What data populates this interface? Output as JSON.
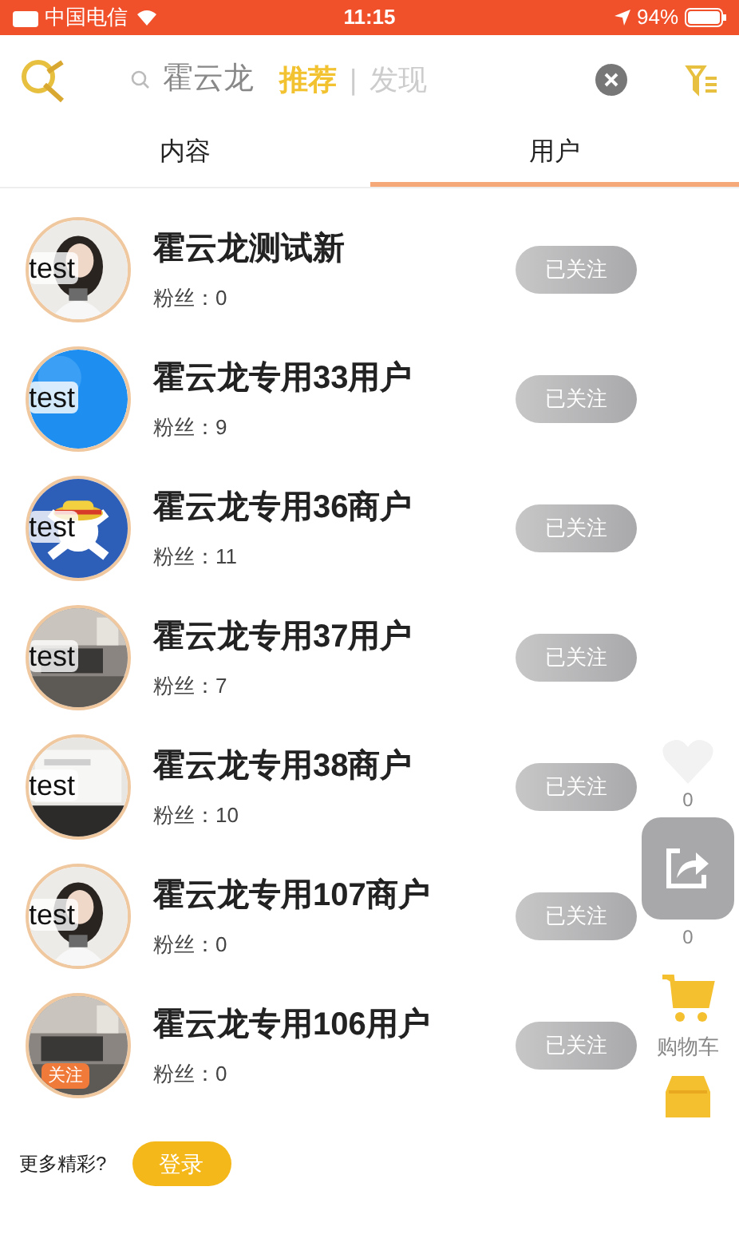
{
  "status_bar": {
    "carrier": "中国电信",
    "time": "11:15",
    "battery": "94%"
  },
  "search": {
    "query": "霍云龙",
    "links": [
      {
        "label": "推荐",
        "selected": true
      },
      {
        "label": "发现",
        "selected": false
      }
    ],
    "separator": "|"
  },
  "tabs": [
    {
      "label": "内容",
      "selected": false
    },
    {
      "label": "用户",
      "selected": true
    }
  ],
  "users": [
    {
      "name": "霍云龙测试新",
      "fans_label": "粉丝：",
      "fans": "0",
      "avatar_label": "test",
      "button": "已关注"
    },
    {
      "name": "霍云龙专用33用户",
      "fans_label": "粉丝：",
      "fans": "9",
      "avatar_label": "test",
      "avatar": {
        "kind": "blue"
      },
      "button": "已关注"
    },
    {
      "name": "霍云龙专用36商户",
      "fans_label": "粉丝：",
      "fans": "11",
      "avatar_label": "test",
      "avatar": {
        "kind": "emblem"
      },
      "button": "已关注"
    },
    {
      "name": "霍云龙专用37用户",
      "fans_label": "粉丝：",
      "fans": "7",
      "avatar_label": "test",
      "avatar": {
        "kind": "room"
      },
      "button": "已关注"
    },
    {
      "name": "霍云龙专用38商户",
      "fans_label": "粉丝：",
      "fans": "10",
      "avatar_label": "test",
      "avatar": {
        "kind": "screen"
      },
      "button": "已关注"
    },
    {
      "name": "霍云龙专用107商户",
      "fans_label": "粉丝：",
      "fans": "0",
      "avatar_label": "test",
      "button": "已关注"
    },
    {
      "name": "霍云龙专用106用户",
      "fans_label": "粉丝：",
      "fans": "0",
      "avatar_badge": "关注",
      "avatar": {
        "kind": "room"
      },
      "button": "已关注"
    }
  ],
  "floating": {
    "likes": "0",
    "shares": "0",
    "cart": "购物车"
  },
  "footer": {
    "prompt": "更多精彩?",
    "login": "登录"
  }
}
